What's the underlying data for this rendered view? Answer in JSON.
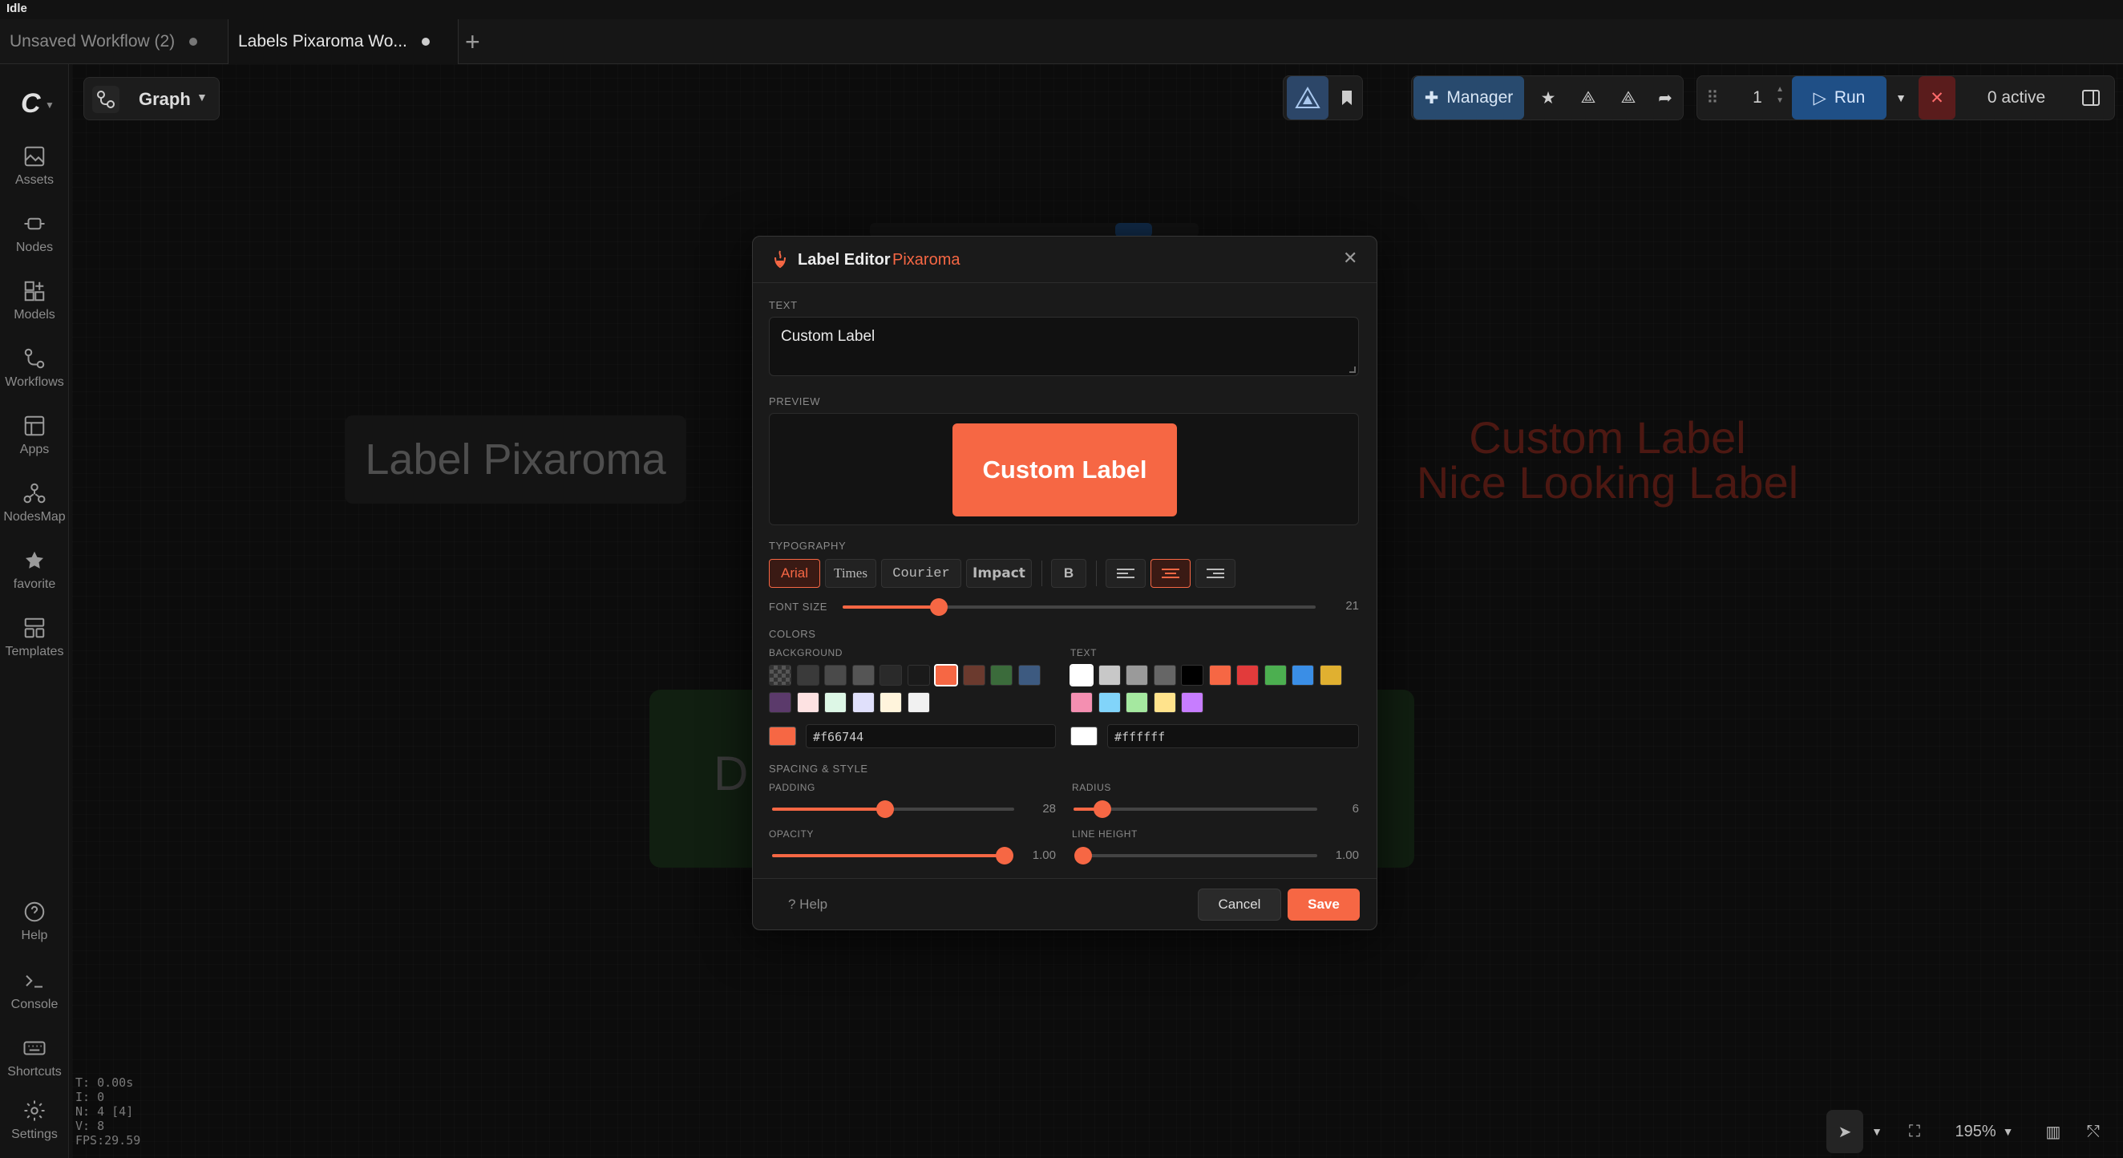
{
  "status": "Idle",
  "tabs": [
    {
      "label": "Unsaved Workflow (2)"
    },
    {
      "label": "Labels Pixaroma Wo..."
    }
  ],
  "sidebar": {
    "items": [
      {
        "label": "Assets",
        "icon": "image-icon"
      },
      {
        "label": "Nodes",
        "icon": "node-icon"
      },
      {
        "label": "Models",
        "icon": "models-icon"
      },
      {
        "label": "Workflows",
        "icon": "workflow-icon"
      },
      {
        "label": "Apps",
        "icon": "apps-icon"
      },
      {
        "label": "NodesMap",
        "icon": "map-icon"
      },
      {
        "label": "favorite",
        "icon": "star-icon"
      },
      {
        "label": "Templates",
        "icon": "templates-icon"
      },
      {
        "label": "Help",
        "icon": "help-icon"
      },
      {
        "label": "Console",
        "icon": "console-icon"
      },
      {
        "label": "Shortcuts",
        "icon": "keyboard-icon"
      },
      {
        "label": "Settings",
        "icon": "gear-icon"
      }
    ]
  },
  "graph": {
    "label": "Graph"
  },
  "toolbar": {
    "manager_label": "Manager",
    "queue_count": "1",
    "run_label": "Run",
    "active_label": "0 active"
  },
  "canvas": {
    "label_node": "Label Pixaroma",
    "red_label_line1": "Custom Label",
    "red_label_line2": "Nice Looking Label",
    "green_node_text": "D"
  },
  "perf": {
    "t": "T: 0.00s",
    "i": "I: 0",
    "n": "N: 4 [4]",
    "v": "V: 8",
    "fps": "FPS:29.59"
  },
  "zoom": {
    "label": "195%"
  },
  "dialog": {
    "title": "Label Editor",
    "brand": "Pixaroma",
    "sections": {
      "text": "TEXT",
      "preview": "PREVIEW",
      "typography": "TYPOGRAPHY",
      "font_size": "FONT SIZE",
      "colors": "COLORS",
      "background": "BACKGROUND",
      "text_color": "TEXT",
      "spacing": "SPACING & STYLE",
      "padding": "PADDING",
      "radius": "RADIUS",
      "opacity": "OPACITY",
      "line_height": "LINE HEIGHT"
    },
    "text_value": "Custom Label",
    "preview_text": "Custom Label",
    "fonts": [
      "Arial",
      "Times",
      "Courier",
      "Impact"
    ],
    "selected_font": "Arial",
    "bold_label": "B",
    "alignment_selected": "center",
    "font_size": {
      "value": 21,
      "min": 8,
      "max": 72,
      "display": "21"
    },
    "padding": {
      "value": 28,
      "min": 0,
      "max": 60,
      "display": "28"
    },
    "radius": {
      "value": 6,
      "min": 0,
      "max": 50,
      "display": "6"
    },
    "opacity": {
      "value": 1.0,
      "min": 0,
      "max": 1,
      "display": "1.00"
    },
    "line_height": {
      "value": 1.0,
      "min": 1.0,
      "max": 3.0,
      "display": "1.00"
    },
    "bg_swatches": [
      "transparent",
      "#3a3a3a",
      "#4a4a4a",
      "#555555",
      "#2a2a2a",
      "#1a1a1a",
      "#f66744",
      "#6b3a2e",
      "#3b6b3b",
      "#3d5a80",
      "#5b3a6b",
      "#fde2e2",
      "#ddf7e6",
      "#e0e0fb",
      "#fff4dc",
      "#f1f1f1"
    ],
    "bg_selected": "#f66744",
    "text_swatches": [
      "#ffffff",
      "#c8c8c8",
      "#9a9a9a",
      "#666666",
      "#000000",
      "#f66744",
      "#e23b3b",
      "#4caf50",
      "#3a8ee6",
      "#e0b030",
      "#f48fb1",
      "#81d4fa",
      "#a5e8a0",
      "#ffe38c",
      "#c77dff"
    ],
    "text_selected": "#ffffff",
    "bg_hex": "#f66744",
    "text_hex": "#ffffff",
    "help_label": "? Help",
    "cancel_label": "Cancel",
    "save_label": "Save"
  },
  "colors": {
    "accent": "#f66744",
    "run": "#1f4f86"
  }
}
